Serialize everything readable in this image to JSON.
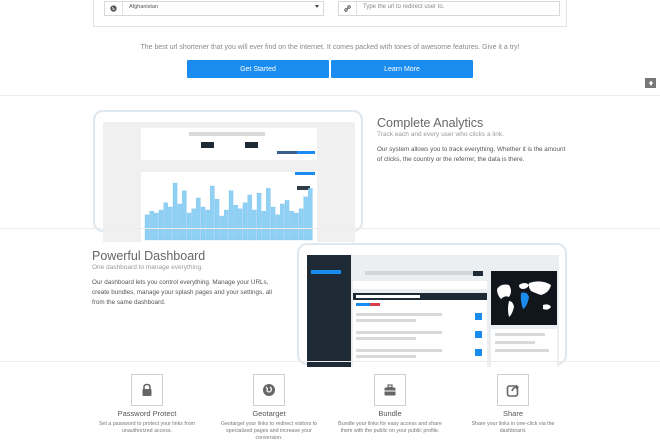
{
  "form": {
    "country_value": "Afghanistan",
    "redirect_placeholder": "Type the url to redirect user to."
  },
  "hero": {
    "tagline": "The best url shortener that you will ever find on the internet. It comes packed with tones of awesome features. Give it a try!",
    "get_started_label": "Get Started",
    "learn_more_label": "Learn More"
  },
  "analytics": {
    "title": "Complete Analytics",
    "subtitle": "Track each and every user who clicks a link.",
    "body": "Our system allows you to track everything. Whether it is the amount of clicks, the country or the referrer, the data is there."
  },
  "dashboard": {
    "title": "Powerful Dashboard",
    "subtitle": "One dashboard to manage everything.",
    "body": "Our dashboard lets you control everything. Manage your URLs, create bundles, manage your splash pages and your settings, all from the same dashboard."
  },
  "features": [
    {
      "icon": "lock-icon",
      "title": "Password Protect",
      "desc": "Set a password to protect your links from unauthorized access."
    },
    {
      "icon": "globe-icon",
      "title": "Geotarget",
      "desc": "Geotarget your links to redirect visitors to specialized pages and increase your conversion."
    },
    {
      "icon": "briefcase-icon",
      "title": "Bundle",
      "desc": "Bundle your links for easy access and share them with the public on your public profile."
    },
    {
      "icon": "share-icon",
      "title": "Share",
      "desc": "Share your links in one-click via the dashboard."
    }
  ],
  "colors": {
    "accent": "#1a8cf0",
    "dark_panel": "#1e2a36",
    "chart_bar": "#8fd0f5"
  },
  "chart_bars": [
    0.42,
    0.48,
    0.45,
    0.5,
    0.62,
    0.55,
    0.95,
    0.6,
    0.82,
    0.45,
    0.52,
    0.7,
    0.55,
    0.5,
    0.9,
    0.68,
    0.4,
    0.5,
    0.82,
    0.58,
    0.52,
    0.62,
    0.75,
    0.5,
    0.78,
    0.48,
    0.86,
    0.55,
    0.42,
    0.6,
    0.66,
    0.48,
    0.45,
    0.52,
    0.72,
    0.86
  ]
}
